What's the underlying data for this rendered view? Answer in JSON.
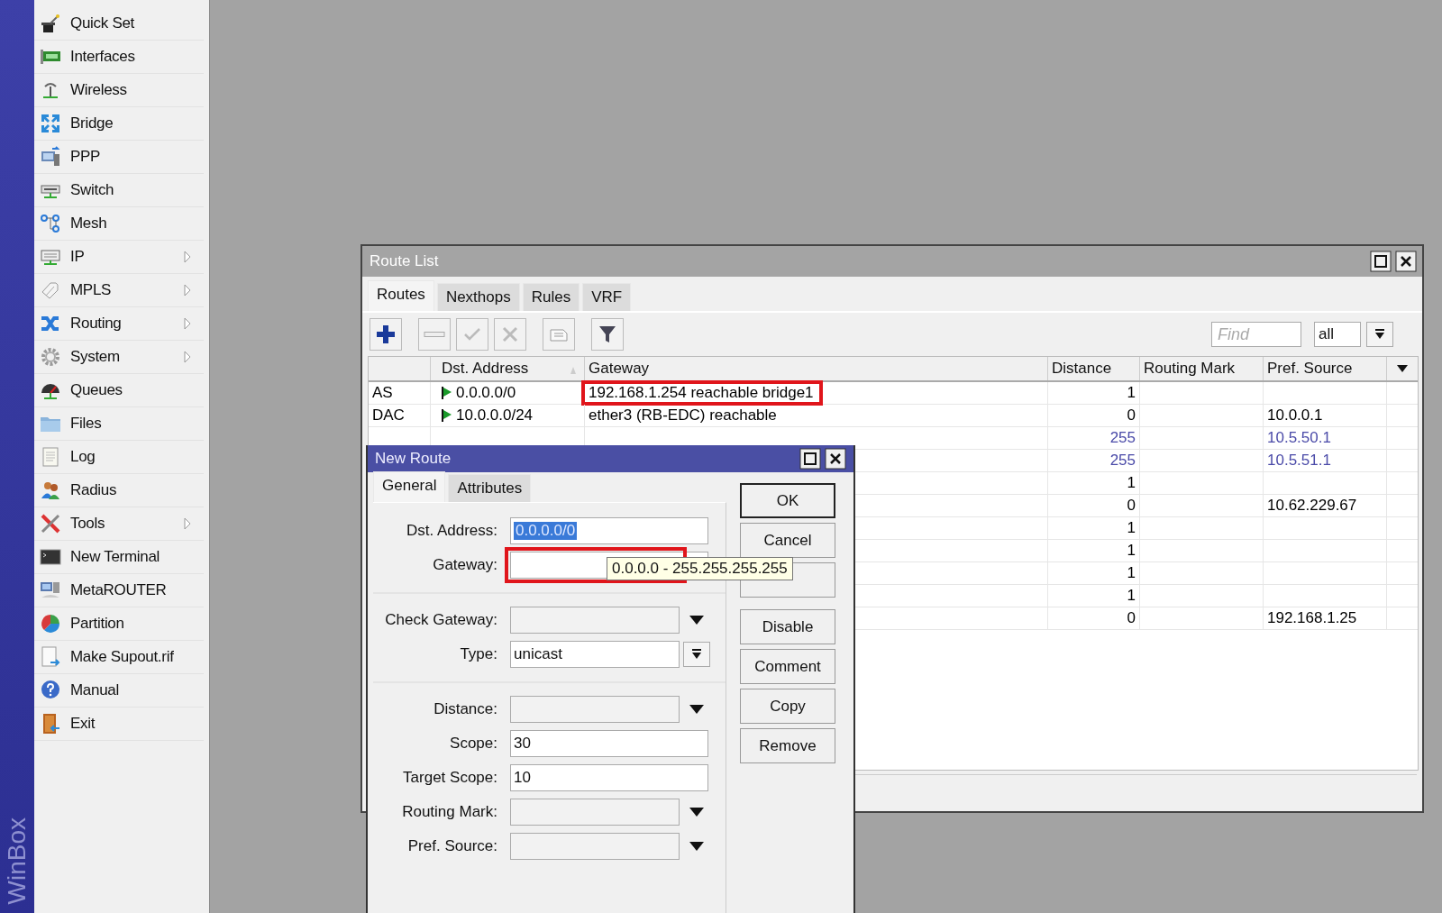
{
  "sidebar": {
    "brand": "WinBox",
    "items": [
      {
        "label": "Quick Set",
        "submenu": false
      },
      {
        "label": "Interfaces",
        "submenu": false
      },
      {
        "label": "Wireless",
        "submenu": false
      },
      {
        "label": "Bridge",
        "submenu": false
      },
      {
        "label": "PPP",
        "submenu": false
      },
      {
        "label": "Switch",
        "submenu": false
      },
      {
        "label": "Mesh",
        "submenu": false
      },
      {
        "label": "IP",
        "submenu": true
      },
      {
        "label": "MPLS",
        "submenu": true
      },
      {
        "label": "Routing",
        "submenu": true
      },
      {
        "label": "System",
        "submenu": true
      },
      {
        "label": "Queues",
        "submenu": false
      },
      {
        "label": "Files",
        "submenu": false
      },
      {
        "label": "Log",
        "submenu": false
      },
      {
        "label": "Radius",
        "submenu": false
      },
      {
        "label": "Tools",
        "submenu": true
      },
      {
        "label": "New Terminal",
        "submenu": false
      },
      {
        "label": "MetaROUTER",
        "submenu": false
      },
      {
        "label": "Partition",
        "submenu": false
      },
      {
        "label": "Make Supout.rif",
        "submenu": false
      },
      {
        "label": "Manual",
        "submenu": false
      },
      {
        "label": "Exit",
        "submenu": false
      }
    ]
  },
  "route_list": {
    "title": "Route List",
    "tabs": [
      {
        "label": "Routes",
        "selected": true
      },
      {
        "label": "Nexthops",
        "selected": false
      },
      {
        "label": "Rules",
        "selected": false
      },
      {
        "label": "VRF",
        "selected": false
      }
    ],
    "toolbar": [
      {
        "disabled": false
      },
      {
        "disabled": true
      },
      {
        "disabled": true
      },
      {
        "disabled": true
      },
      {
        "disabled": true
      },
      {
        "disabled": false
      }
    ],
    "find": {
      "placeholder": "Find"
    },
    "filter": {
      "value": "all"
    },
    "table": {
      "columns": [
        {
          "label": "Dst. Address",
          "sorted": true
        },
        {
          "label": "Gateway",
          "sorted": false
        },
        {
          "label": "Distance",
          "sorted": false
        },
        {
          "label": "Routing Mark",
          "sorted": false
        },
        {
          "label": "Pref. Source",
          "sorted": false
        }
      ],
      "rows": [
        {
          "flags": "AS",
          "active": true,
          "dst": "0.0.0.0/0",
          "gateway": "192.168.1.254 reachable bridge1",
          "highlighted": true,
          "distance": "1",
          "color": "#000000"
        },
        {
          "flags": "DAC",
          "active": true,
          "dst": "10.0.0.0/24",
          "gateway": "ether3 (RB-EDC) reachable",
          "highlighted": false,
          "distance": "0",
          "pref_source": "10.0.0.1",
          "color": "#000000"
        },
        {
          "distance": "255",
          "pref_source": "10.5.50.1",
          "color": "#4a4aa8"
        },
        {
          "distance": "255",
          "pref_source": "10.5.51.1",
          "color": "#4a4aa8"
        },
        {
          "distance": "1",
          "color": "#000000"
        },
        {
          "distance": "0",
          "pref_source": "10.62.229.67",
          "color": "#000000"
        },
        {
          "distance": "1",
          "color": "#000000"
        },
        {
          "distance": "1",
          "color": "#000000"
        },
        {
          "distance": "1",
          "color": "#000000"
        },
        {
          "distance": "1",
          "color": "#000000"
        },
        {
          "distance": "0",
          "pref_source": "192.168.1.25",
          "color": "#000000"
        }
      ]
    }
  },
  "dialog": {
    "title": "New Route",
    "tabs": [
      {
        "label": "General",
        "selected": true
      },
      {
        "label": "Attributes",
        "selected": false
      }
    ],
    "groups": [
      [
        {
          "label": "Dst. Address:",
          "kind": "text",
          "value": "0.0.0.0/0",
          "text_selected": true
        },
        {
          "label": "Gateway:",
          "kind": "text",
          "highlighted": true
        }
      ],
      [
        {
          "label": "Check Gateway:",
          "kind": "dropdown"
        },
        {
          "label": "Type:",
          "kind": "select",
          "value": "unicast"
        }
      ],
      [
        {
          "label": "Distance:",
          "kind": "dropdown"
        },
        {
          "label": "Scope:",
          "kind": "text",
          "value": "30"
        },
        {
          "label": "Target Scope:",
          "kind": "text",
          "value": "10"
        },
        {
          "label": "Routing Mark:",
          "kind": "dropdown"
        },
        {
          "label": "Pref. Source:",
          "kind": "dropdown"
        }
      ]
    ],
    "buttons": [
      [
        {
          "label": "OK",
          "default": true
        },
        {
          "label": "Cancel",
          "default": false
        },
        {
          "default": false
        }
      ],
      [
        {
          "label": "Disable",
          "default": false
        },
        {
          "label": "Comment",
          "default": false
        },
        {
          "label": "Copy",
          "default": false
        },
        {
          "label": "Remove",
          "default": false
        }
      ]
    ],
    "tooltip": "0.0.0.0 - 255.255.255.255"
  }
}
